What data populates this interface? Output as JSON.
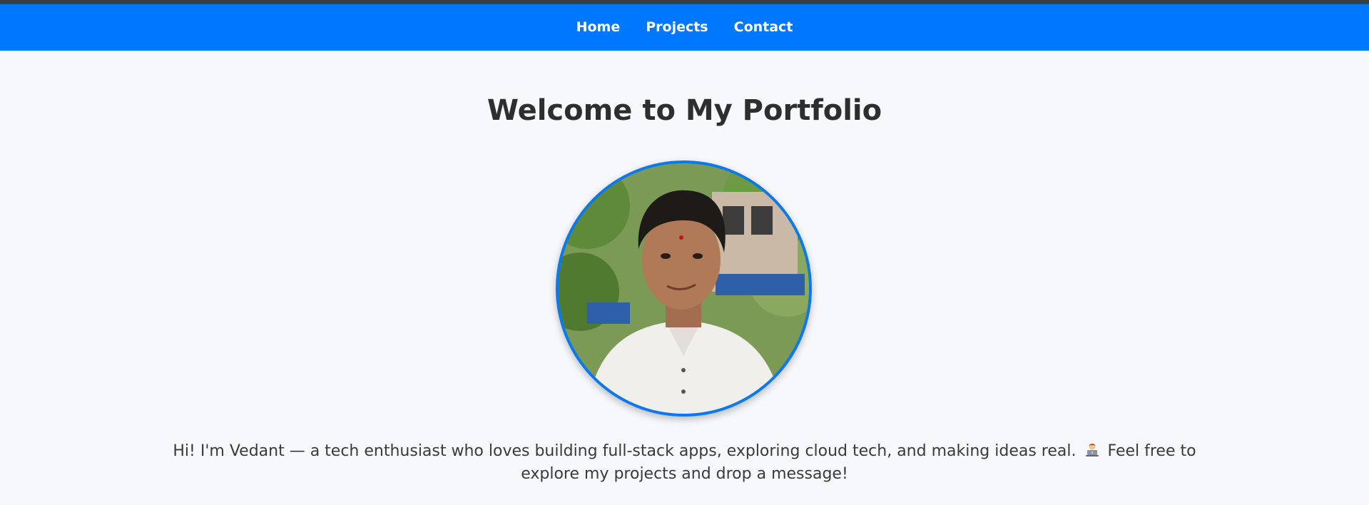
{
  "nav": {
    "items": [
      {
        "label": "Home"
      },
      {
        "label": "Projects"
      },
      {
        "label": "Contact"
      }
    ]
  },
  "hero": {
    "title": "Welcome to My Portfolio",
    "intro_before_emoji": "Hi! I'm Vedant — a tech enthusiast who loves building full-stack apps, exploring cloud tech, and making ideas real.",
    "intro_after_emoji": "Feel free to explore my projects and drop a message!",
    "emoji_icon": "technologist-emoji-icon"
  },
  "colors": {
    "navbar": "#0077ff",
    "avatar_border": "#0a78f0",
    "background": "#f6f8fb"
  }
}
